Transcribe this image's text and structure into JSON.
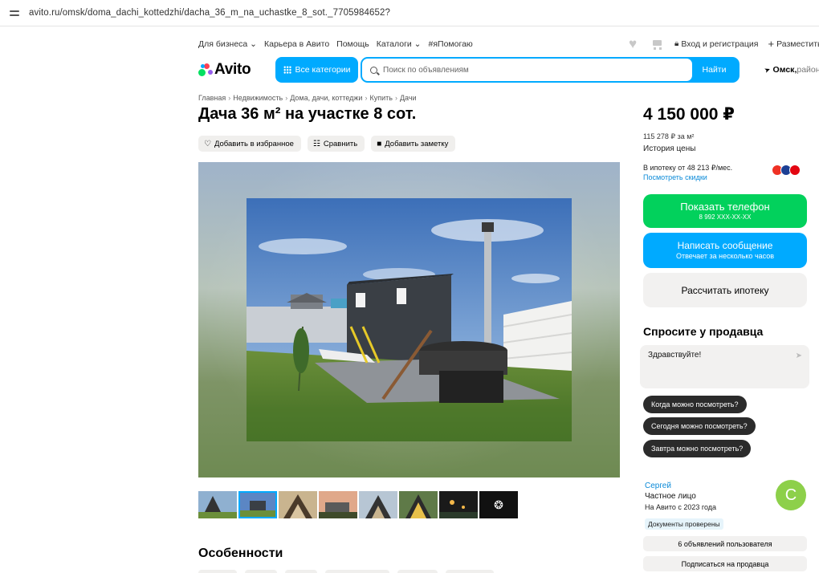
{
  "browser": {
    "url": "avito.ru/omsk/doma_dachi_kottedzhi/dacha_36_m_na_uchastke_8_sot._7705984652?"
  },
  "topnav": {
    "links": [
      "Для бизнеса ⌄",
      "Карьера в Авито",
      "Помощь",
      "Каталоги ⌄",
      "#яПомогаю"
    ],
    "login": "Вход и регистрация",
    "post": "Разместить"
  },
  "header": {
    "logo_text": "Avito",
    "categories_button": "Все категории",
    "search_placeholder": "Поиск по объявлениям",
    "search_button": "Найти",
    "city": "Омск,",
    "city_rest": " район"
  },
  "breadcrumb": [
    "Главная",
    "Недвижимость",
    "Дома, дачи, коттеджи",
    "Купить",
    "Дачи"
  ],
  "listing": {
    "title": "Дача 36 м² на участке 8 сот.",
    "actions": {
      "favorite": "Добавить в избранное",
      "compare": "Сравнить",
      "note": "Добавить заметку"
    },
    "thumb_more_icon": "camera-aperture-icon",
    "features_title": "Особенности"
  },
  "sidebar": {
    "price": "4 150 000 ₽",
    "price_per_m2": "115 278 ₽ за м²",
    "price_history": "История цены",
    "mortgage_text": "В ипотеку от 48 213 ₽/мес.",
    "discounts_link": "Посмотреть скидки",
    "show_phone": "Показать телефон",
    "phone_masked": "8 992 XXX-XX-XX",
    "write_message": "Написать сообщение",
    "reply_time": "Отвечает за несколько часов",
    "calc_mortgage": "Рассчитать ипотеку",
    "ask_title": "Спросите у продавца",
    "message_default": "Здравствуйте!",
    "quick_questions": [
      "Когда можно посмотреть?",
      "Сегодня можно посмотреть?",
      "Завтра можно посмотреть?"
    ],
    "seller_name": "Сергей",
    "seller_type": "Частное лицо",
    "seller_since": "На Авито с 2023 года",
    "docs_verified": "Документы проверены",
    "avatar_letter": "С",
    "user_ads": "6 объявлений пользователя",
    "subscribe": "Подписаться на продавца"
  },
  "colors": {
    "accent_blue": "#00aaff",
    "phone_green": "#02d15c",
    "link_blue": "#0a8ad8",
    "avatar_green": "#8dd04a"
  }
}
